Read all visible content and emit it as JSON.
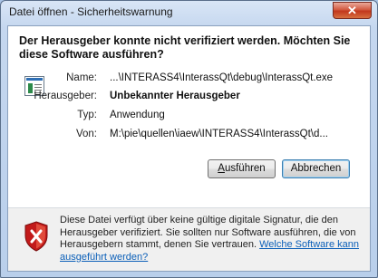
{
  "window": {
    "title": "Datei öffnen - Sicherheitswarnung",
    "close_label": "✕"
  },
  "dialog": {
    "heading": "Der Herausgeber konnte nicht verifiziert werden. Möchten Sie diese Software ausführen?",
    "fields": {
      "name_label": "Name:",
      "name_value": "...\\INTERASS4\\InterassQt\\debug\\InterassQt.exe",
      "publisher_label": "Herausgeber:",
      "publisher_value": "Unbekannter Herausgeber",
      "type_label": "Typ:",
      "type_value": "Anwendung",
      "from_label": "Von:",
      "from_value": "M:\\pie\\quellen\\iaew\\INTERASS4\\InterassQt\\d..."
    },
    "buttons": {
      "run_mnemonic": "A",
      "run_rest": "usführen",
      "cancel_label": "Abbrechen"
    },
    "footer": {
      "text": "Diese Datei verfügt über keine gültige digitale Signatur, die den Herausgeber verifiziert. Sie sollten nur Software ausführen, die von Herausgebern stammt, denen Sie vertrauen. ",
      "link": "Welche Software kann ausgeführt werden?"
    }
  },
  "colors": {
    "accent": "#0b5fb8",
    "close_button": "#c2371c",
    "shield": "#c21a1a"
  },
  "icons": {
    "app": "application-window-icon",
    "shield": "security-warning-shield-icon",
    "close": "close-icon"
  }
}
